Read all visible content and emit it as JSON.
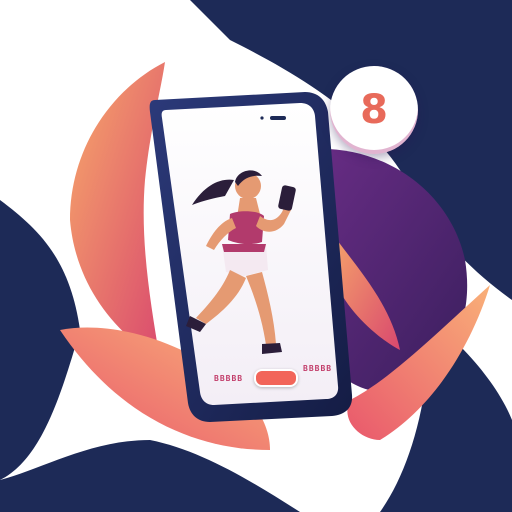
{
  "phone": {
    "label_left": "BBBBB",
    "label_right": "BBBBB"
  },
  "badge": {
    "glyph": "8",
    "icon": "stopwatch-icon"
  },
  "colors": {
    "navy": "#1d2a57",
    "purple": "#5a2a7a",
    "orange": "#f58a5a",
    "coral": "#f2655a",
    "pink": "#c23d6a"
  }
}
